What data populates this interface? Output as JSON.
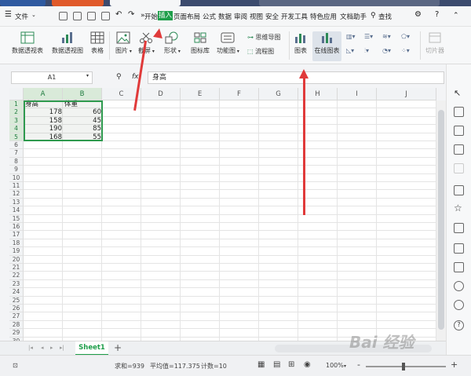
{
  "menubar": {
    "file_label": "文件",
    "items": [
      "开始",
      "插入",
      "页面布局",
      "公式",
      "数据",
      "审阅",
      "视图",
      "安全",
      "开发工具",
      "特色应用",
      "文档助手"
    ],
    "search_label": "查找",
    "more_label": "»"
  },
  "ribbon": {
    "pivot_table": "数据透视表",
    "pivot_chart": "数据透视图",
    "table": "表格",
    "picture": "图片",
    "screenshot": "截屏",
    "shape": "形状",
    "icon_lib": "图标库",
    "func_chart": "功能图",
    "mindmap": "思维导图",
    "flowchart": "流程图",
    "chart": "图表",
    "online_chart": "在线图表",
    "slicer": "切片器"
  },
  "formula_bar": {
    "name_box": "A1",
    "fx_label": "fx",
    "content": "身高"
  },
  "grid": {
    "columns": [
      "A",
      "B",
      "C",
      "D",
      "E",
      "F",
      "G",
      "H",
      "I",
      "J"
    ],
    "rows": [
      "1",
      "2",
      "3",
      "4",
      "5",
      "6",
      "7",
      "8",
      "9",
      "10",
      "11",
      "12",
      "13",
      "14",
      "15",
      "16",
      "17",
      "18",
      "19",
      "20",
      "21",
      "22",
      "23",
      "24",
      "25",
      "26",
      "27",
      "28",
      "29",
      "30"
    ],
    "header_a": "身高",
    "header_b": "体重",
    "data": [
      {
        "a": "178",
        "b": "60"
      },
      {
        "a": "158",
        "b": "45"
      },
      {
        "a": "190",
        "b": "85"
      },
      {
        "a": "168",
        "b": "55"
      }
    ]
  },
  "sheets": {
    "active": "Sheet1",
    "add_label": "+"
  },
  "status": {
    "sum": "求和=939",
    "average": "平均值=117.375",
    "count": "计数=10",
    "zoom": "100%",
    "zoom_minus": "-",
    "zoom_plus": "+"
  },
  "watermark": "Bai 经验",
  "colors": {
    "accent_green": "#1e9e4a",
    "annotation_red": "#e03a3a",
    "titlebar": "#3c4b6e"
  }
}
